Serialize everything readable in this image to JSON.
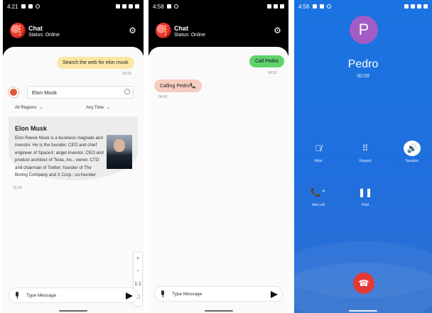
{
  "screen1": {
    "status_time": "4:21",
    "chat_title": "Chat",
    "chat_status": "Status: Online",
    "user_message": "Search the web for elon musk",
    "user_time": "10:19",
    "search_value": "Elon Musk",
    "filter_region": "All Regions",
    "filter_time": "Any Time",
    "result_title": "Elon Musk",
    "result_text": "Elon Reeve Musk is a business magnate and investor. He is the founder, CEO and chief engineer of SpaceX; angel investor, CEO and product architect of Tesla, Inc.; owner, CTO and chairman of Twitter; founder of The Boring Company and X Corp.; co-founder",
    "result_time": "10:19",
    "zoom_plus": "+",
    "zoom_minus": "−",
    "zoom_ratio": "1:1",
    "input_placeholder": "Type Message"
  },
  "screen2": {
    "status_time": "4:58",
    "chat_title": "Chat",
    "chat_status": "Status: Online",
    "user_message": "Call Pedro",
    "user_time": "04:53",
    "bot_message": "Calling Pedro📞",
    "bot_time": "04:55",
    "input_placeholder": "Type Message"
  },
  "screen3": {
    "status_time": "4:56",
    "avatar_letter": "P",
    "caller_name": "Pedro",
    "duration": "00:09",
    "controls": [
      {
        "label": "Mute",
        "icon": "mic-off-icon"
      },
      {
        "label": "Keypad",
        "icon": "keypad-icon"
      },
      {
        "label": "Speaker",
        "icon": "speaker-icon"
      },
      {
        "label": "Add call",
        "icon": "add-call-icon"
      },
      {
        "label": "Hold",
        "icon": "pause-icon"
      }
    ]
  },
  "colors": {
    "user_bubble_yellow": "#fbe7a4",
    "user_bubble_green": "#5fd36a",
    "bot_bubble": "#f6cdbf",
    "call_bg": "#1a73e0",
    "end_call": "#e53935",
    "avatar": "#a35cc4"
  }
}
